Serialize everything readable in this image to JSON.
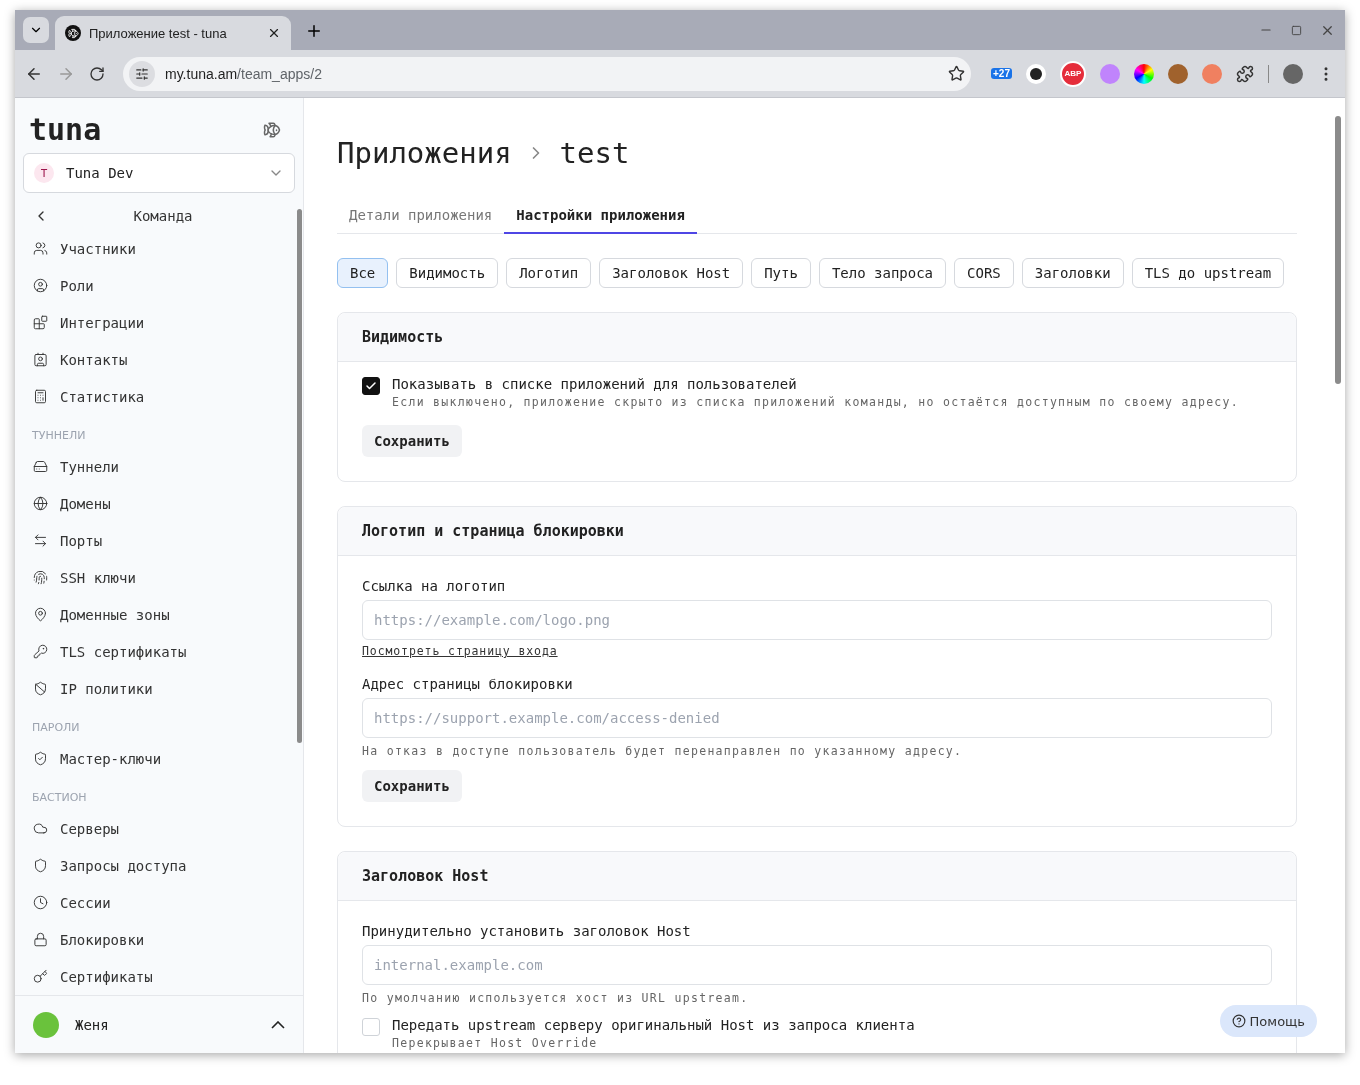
{
  "browser": {
    "tab_title": "Приложение test - tuna",
    "url_host": "my.tuna.am",
    "url_path": "/team_apps/2",
    "extension_badge": "+27",
    "extension_badge_abp": "ABP"
  },
  "sidebar": {
    "logo": "tuna",
    "team": {
      "initial": "T",
      "name": "Tuna Dev"
    },
    "back_label": "Команда",
    "sections": [
      {
        "items": [
          "Участники",
          "Роли",
          "Интеграции",
          "Контакты",
          "Статистика"
        ]
      },
      {
        "heading": "ТУННЕЛИ",
        "items": [
          "Туннели",
          "Домены",
          "Порты",
          "SSH ключи",
          "Доменные зоны",
          "TLS сертификаты",
          "IP политики"
        ]
      },
      {
        "heading": "ПАРОЛИ",
        "items": [
          "Мастер-ключи"
        ]
      },
      {
        "heading": "БАСТИОН",
        "items": [
          "Серверы",
          "Запросы доступа",
          "Сессии",
          "Блокировки",
          "Сертификаты"
        ]
      }
    ],
    "user": {
      "name": "Женя"
    }
  },
  "main": {
    "breadcrumb": [
      "Приложения",
      "test"
    ],
    "tabs": [
      {
        "label": "Детали приложения",
        "selected": false
      },
      {
        "label": "Настройки приложения",
        "selected": true
      }
    ],
    "filters": [
      {
        "label": "Все",
        "selected": true
      },
      {
        "label": "Видимость",
        "selected": false
      },
      {
        "label": "Логотип",
        "selected": false
      },
      {
        "label": "Заголовок Host",
        "selected": false
      },
      {
        "label": "Путь",
        "selected": false
      },
      {
        "label": "Тело запроса",
        "selected": false
      },
      {
        "label": "CORS",
        "selected": false
      },
      {
        "label": "Заголовки",
        "selected": false
      },
      {
        "label": "TLS до upstream",
        "selected": false
      }
    ],
    "cards": [
      {
        "title": "Видимость",
        "fields": [
          {
            "kind": "checkbox",
            "label": "Показывать в списке приложений для пользователей",
            "hint": "Если выключено, приложение скрыто из списка приложений команды, но остаётся доступным по своему адресу.",
            "checked": true
          },
          {
            "kind": "button",
            "label": "Сохранить"
          }
        ]
      },
      {
        "title": "Логотип и страница блокировки",
        "fields": [
          {
            "kind": "input",
            "label": "Ссылка на логотип",
            "placeholder": "https://example.com/logo.png"
          },
          {
            "kind": "link",
            "label": "Посмотреть страницу входа"
          },
          {
            "kind": "input",
            "label": "Адрес страницы блокировки",
            "placeholder": "https://support.example.com/access-denied",
            "hint": "На отказ в доступе пользователь будет перенаправлен по указанному адресу."
          },
          {
            "kind": "button",
            "label": "Сохранить"
          }
        ]
      },
      {
        "title": "Заголовок Host",
        "fields": [
          {
            "kind": "input",
            "label": "Принудительно установить заголовок Host",
            "placeholder": "internal.example.com",
            "hint": "По умолчанию используется хост из URL upstream."
          },
          {
            "kind": "checkbox",
            "label": "Передать upstream серверу оригинальный Host из запроса клиента",
            "hint": "Перекрывает Host Override",
            "checked": false
          }
        ]
      }
    ]
  },
  "help": {
    "label": "Помощь"
  }
}
